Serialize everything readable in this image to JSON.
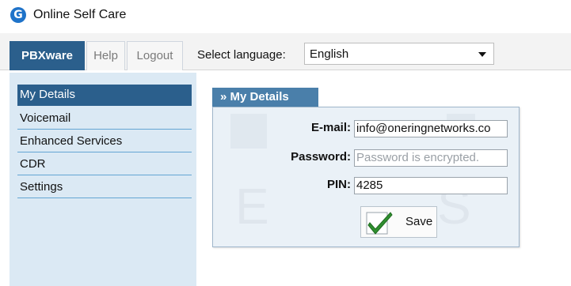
{
  "app": {
    "title": "Online Self Care",
    "logo_glyph": "G"
  },
  "topnav": {
    "tabs": [
      {
        "label": "PBXware",
        "active": true
      },
      {
        "label": "Help",
        "active": false
      },
      {
        "label": "Logout",
        "active": false
      }
    ],
    "language_label": "Select language:",
    "language_value": "English"
  },
  "sidebar": {
    "items": [
      {
        "label": "My Details",
        "active": true
      },
      {
        "label": "Voicemail",
        "active": false
      },
      {
        "label": "Enhanced Services",
        "active": false
      },
      {
        "label": "CDR",
        "active": false
      },
      {
        "label": "Settings",
        "active": false
      }
    ]
  },
  "main": {
    "panel_title": "» My Details",
    "watermark": [
      "E",
      "S"
    ],
    "email_label": "E-mail:",
    "email_value": "info@oneringnetworks.co",
    "password_label": "Password:",
    "password_placeholder": "Password is encrypted.",
    "pin_label": "PIN:",
    "pin_value": "4285",
    "save_label": "Save"
  },
  "colors": {
    "accent": "#2b5f8c",
    "panel_header": "#4a7faa",
    "sidebar_bg": "#dbe9f4",
    "sidebar_divider": "#63a5d3",
    "panel_bg": "#eaf1f7",
    "check_green": "#2f8f2f"
  }
}
